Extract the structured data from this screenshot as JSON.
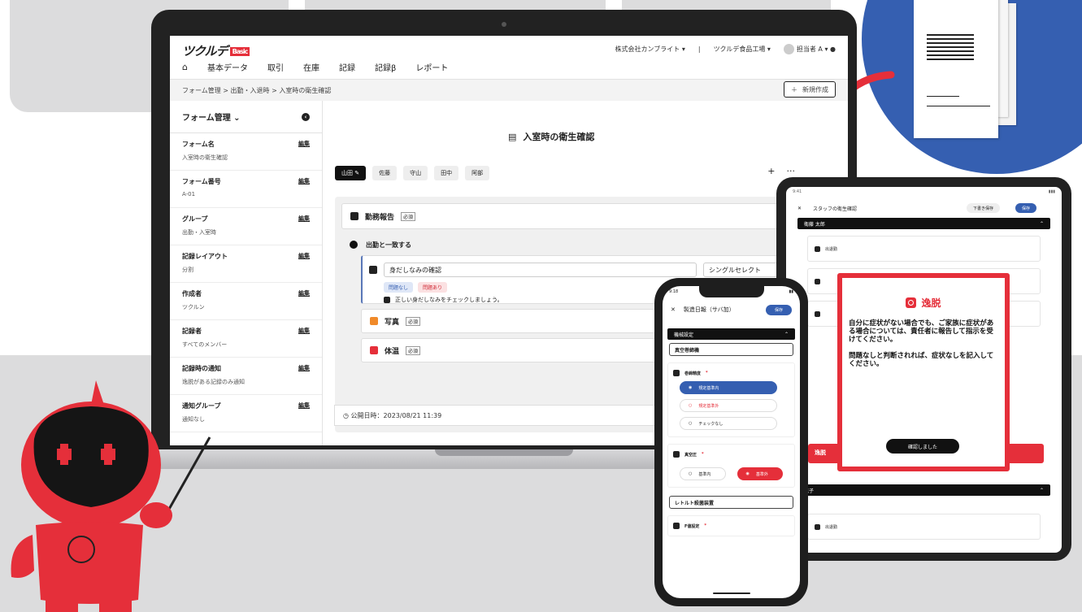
{
  "laptop": {
    "logo": "ツクルデ",
    "logo_badge": "Basic",
    "nav": [
      "基本データ",
      "取引",
      "在庫",
      "記録",
      "記録β",
      "レポート"
    ],
    "company": "株式会社カンブライト ▾",
    "factory": "ツクルデ食品工場 ▾",
    "user": "担当者 A ▾",
    "breadcrumb": "フォーム管理 > 出勤・入退時 > 入室時の衛生確認",
    "new_button": "新規作成",
    "sidebar": {
      "title": "フォーム管理 ⌄",
      "edit_label": "編集",
      "items": [
        {
          "label": "フォーム名",
          "value": "入室時の衛生確認"
        },
        {
          "label": "フォーム番号",
          "value": "A-01"
        },
        {
          "label": "グループ",
          "value": "出勤・入室時"
        },
        {
          "label": "記録レイアウト",
          "value": "分割"
        },
        {
          "label": "作成者",
          "value": "ツクルン"
        },
        {
          "label": "記録者",
          "value": "すべてのメンバー"
        },
        {
          "label": "記録時の通知",
          "value": "逸脱がある記録のみ通知"
        },
        {
          "label": "通知グループ",
          "value": "通知なし"
        }
      ]
    },
    "form_title": "入室時の衛生確認",
    "tabs": [
      "山田",
      "佐藤",
      "守山",
      "田中",
      "阿部"
    ],
    "tab_actions": [
      "+",
      "···"
    ],
    "section1": "勤務報告",
    "required": "必須",
    "subhead": "出勤と一致する",
    "question": "身だしなみの確認",
    "select_value": "シングルセレクト",
    "chip_ok": "問題なし",
    "chip_ng": "問題あり",
    "hint": "正しい身だしなみをチェックしましょう。",
    "photo": "写真",
    "temp": "体温",
    "publish": "公開日時：2023/08/21 11:39"
  },
  "tablet": {
    "header_title": "スタッフの衛生確認",
    "draft_btn": "下書き保存",
    "save_btn": "保存",
    "bar1": "衛藤 太郎",
    "bar2": "花子",
    "field": "出退勤",
    "red_bar": "逸脱"
  },
  "modal": {
    "title": "逸脱",
    "body1": "自分に症状がない場合でも、ご家族に症状がある場合については、責任者に報告して指示を受けてください。",
    "body2": "問題なしと判断されれば、症状なしを記入してください。",
    "confirm": "確認しました"
  },
  "phone": {
    "time": "9:18",
    "title": "製造日報（サバ加）",
    "save": "保存",
    "bar": "機械設定",
    "field1": "真空巻締機",
    "q1": "巻締精度",
    "opt1": "規定基準内",
    "opt2": "規定基準外",
    "opt3": "チェックなし",
    "q2": "真空圧",
    "opt4": "基準内",
    "opt5": "基準外",
    "field2": "レトルト殺菌装置",
    "q3": "F値設定"
  },
  "colors": {
    "brand_red": "#e52f3a",
    "brand_blue": "#355fb1",
    "bg_gray": "#dcdcdd"
  }
}
